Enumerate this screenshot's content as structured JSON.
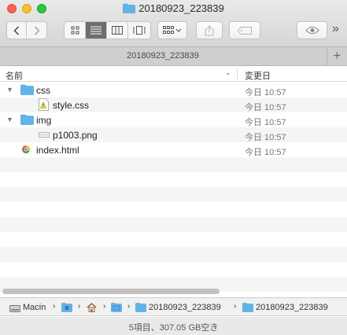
{
  "window": {
    "title": "20180923_223839"
  },
  "toolbar": {
    "back_icon": "chevron-left-icon",
    "forward_icon": "chevron-right-icon",
    "view_modes": [
      "icon-view-icon",
      "list-view-icon",
      "column-view-icon",
      "gallery-view-icon"
    ],
    "active_view": "list-view-icon",
    "arrange_icon": "grid-arrange-icon",
    "share_icon": "share-icon",
    "tag_icon": "tag-icon",
    "quicklook_icon": "eye-icon",
    "overflow_label": "»"
  },
  "tabbar": {
    "tab_label": "20180923_223839",
    "add_label": "+"
  },
  "columns": {
    "name": "名前",
    "sort_indicator": "⌄",
    "date": "変更日"
  },
  "files": [
    {
      "name": "css",
      "date": "今日 10:57",
      "disclosure": "▼",
      "icon": "folder-icon"
    },
    {
      "name": "style.css",
      "date": "今日 10:57",
      "disclosure": "",
      "icon": "css-file-icon"
    },
    {
      "name": "img",
      "date": "今日 10:57",
      "disclosure": "▼",
      "icon": "folder-icon"
    },
    {
      "name": "p1003.png",
      "date": "今日 10:57",
      "disclosure": "",
      "icon": "png-file-icon"
    },
    {
      "name": "index.html",
      "date": "今日 10:57",
      "disclosure": "",
      "icon": "html-file-icon"
    }
  ],
  "pathbar": {
    "items": [
      {
        "label": "Macin",
        "icon": "hard-drive-icon"
      },
      {
        "label": "",
        "icon": "user-folder-icon"
      },
      {
        "label": "",
        "icon": "home-icon"
      },
      {
        "label": "",
        "icon": "folder-icon"
      },
      {
        "label": "20180923_223839",
        "icon": "folder-icon"
      },
      {
        "label": "20180923_223839",
        "icon": "folder-icon"
      }
    ],
    "separator": "›"
  },
  "status": {
    "text": "5項目、307.05 GB空き"
  },
  "colors": {
    "folder_blue": "#5fb4ea",
    "close": "#fc5f57",
    "minimize": "#fdbc2e",
    "zoom": "#28c840"
  }
}
